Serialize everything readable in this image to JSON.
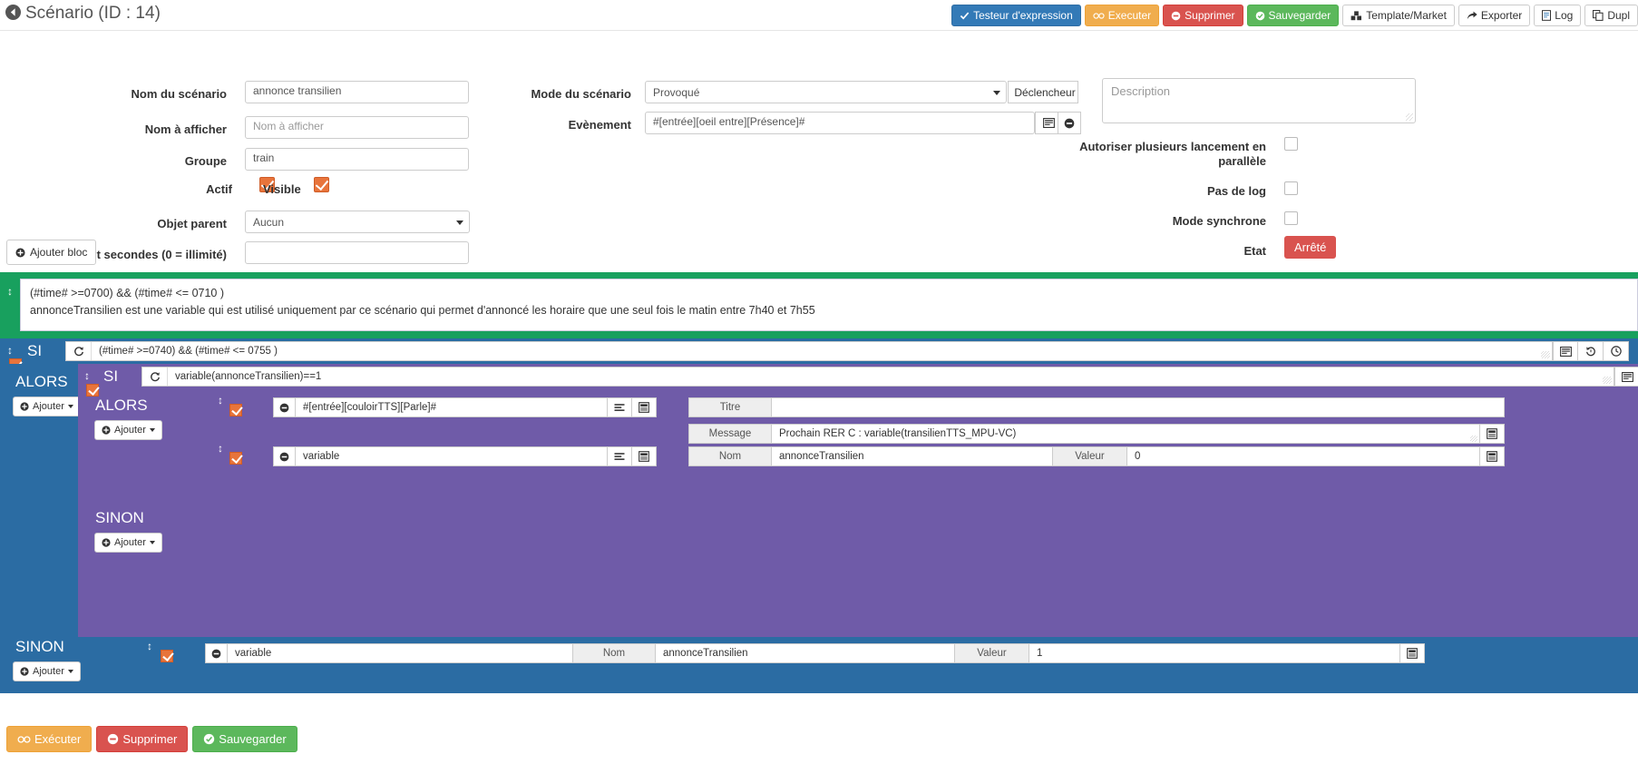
{
  "header": {
    "title": "Scénario (ID : 14)",
    "back_icon": "back-arrow-icon",
    "buttons": [
      {
        "label": "Testeur d'expression",
        "icon": "check-icon",
        "style": "primary"
      },
      {
        "label": "Executer",
        "icon": "gears-icon",
        "style": "warning"
      },
      {
        "label": "Supprimer",
        "icon": "minus-circle-icon",
        "style": "danger"
      },
      {
        "label": "Sauvegarder",
        "icon": "check-circle-icon",
        "style": "success"
      },
      {
        "label": "Template/Market",
        "icon": "cubes-icon",
        "style": "default"
      },
      {
        "label": "Exporter",
        "icon": "share-icon",
        "style": "default"
      },
      {
        "label": "Log",
        "icon": "file-text-icon",
        "style": "default"
      },
      {
        "label": "Dupl",
        "icon": "copy-icon",
        "style": "default"
      }
    ]
  },
  "form": {
    "nom_scenario": {
      "label": "Nom du scénario",
      "value": "annonce transilien"
    },
    "nom_afficher": {
      "label": "Nom à afficher",
      "value": "",
      "placeholder": "Nom à afficher"
    },
    "groupe": {
      "label": "Groupe",
      "value": "train"
    },
    "actif": {
      "label": "Actif",
      "checked": true
    },
    "visible": {
      "label": "Visible",
      "checked": true
    },
    "objet_parent": {
      "label": "Objet parent",
      "value": "Aucun"
    },
    "timeout": {
      "label": "Timeout secondes (0 = illimité)",
      "value": ""
    },
    "mode_scenario": {
      "label": "Mode du scénario",
      "value": "Provoqué"
    },
    "declencheur_btn": {
      "label": "Déclencheur",
      "icon": "plus-square-icon"
    },
    "evenement": {
      "label": "Evènement",
      "value": "#[entrée][oeil entre][Présence]#"
    },
    "description": {
      "value": "",
      "placeholder": "Description"
    },
    "autoriser_parallele": {
      "label": "Autoriser plusieurs lancement en parallèle",
      "checked": false
    },
    "pas_de_log": {
      "label": "Pas de log",
      "checked": false
    },
    "mode_synchrone": {
      "label": "Mode synchrone",
      "checked": false
    },
    "etat": {
      "label": "Etat",
      "value": "Arrêté",
      "color": "#d9534f"
    }
  },
  "ajouter_bloc": {
    "label": "Ajouter bloc",
    "icon": "plus-circle-icon"
  },
  "blocks": {
    "code_block": {
      "color": "#18a05e",
      "line1": "(#time# >=0700) && (#time# <= 0710 )",
      "line2": "annonceTransilien est une variable qui est utilisé uniquement par ce scénario qui permet d'annoncé les horaire que une seul fois le matin entre 7h40 et 7h55"
    },
    "si_outer": {
      "color": "#2b6ca3",
      "keyword": "SI",
      "expression": "(#time# >=0740) && (#time# <= 0755 )",
      "checked": true,
      "alors_label": "ALORS",
      "sinon_label": "SINON",
      "ajouter_label": "Ajouter",
      "icons": [
        "list-icon",
        "history-icon",
        "clock-icon"
      ]
    },
    "si_inner": {
      "color": "#6f5ba8",
      "keyword": "SI",
      "expression": "variable(annonceTransilien)==1",
      "checked": true,
      "alors_label": "ALORS",
      "sinon_label": "SINON",
      "ajouter_label": "Ajouter",
      "icons": [
        "list-icon",
        "history-icon",
        "clock-icon"
      ]
    },
    "actions_inner": [
      {
        "checked": true,
        "command": "#[entrée][couloirTTS][Parle]#",
        "icons": [
          "list-icon",
          "book-icon"
        ],
        "fields": [
          {
            "label": "Titre",
            "value": ""
          },
          {
            "label": "Message",
            "value": "Prochain RER C : variable(transilienTTS_MPU-VC)",
            "icon": "book-icon"
          }
        ]
      },
      {
        "checked": true,
        "command": "variable",
        "icons": [
          "list-icon",
          "book-icon"
        ],
        "fields": [
          {
            "label": "Nom",
            "value": "annonceTransilien"
          },
          {
            "label": "Valeur",
            "value": "0",
            "icon": "book-icon"
          }
        ]
      }
    ],
    "action_sinon_outer": {
      "checked": true,
      "command": "variable",
      "icons": [
        "list-icon",
        "book-icon"
      ],
      "fields": [
        {
          "label": "Nom",
          "value": "annonceTransilien"
        },
        {
          "label": "Valeur",
          "value": "1",
          "icon": "book-icon"
        }
      ]
    }
  },
  "footer": {
    "buttons": [
      {
        "label": "Exécuter",
        "icon": "gears-icon",
        "style": "warning"
      },
      {
        "label": "Supprimer",
        "icon": "minus-circle-icon",
        "style": "danger"
      },
      {
        "label": "Sauvegarder",
        "icon": "check-circle-icon",
        "style": "success"
      }
    ]
  }
}
